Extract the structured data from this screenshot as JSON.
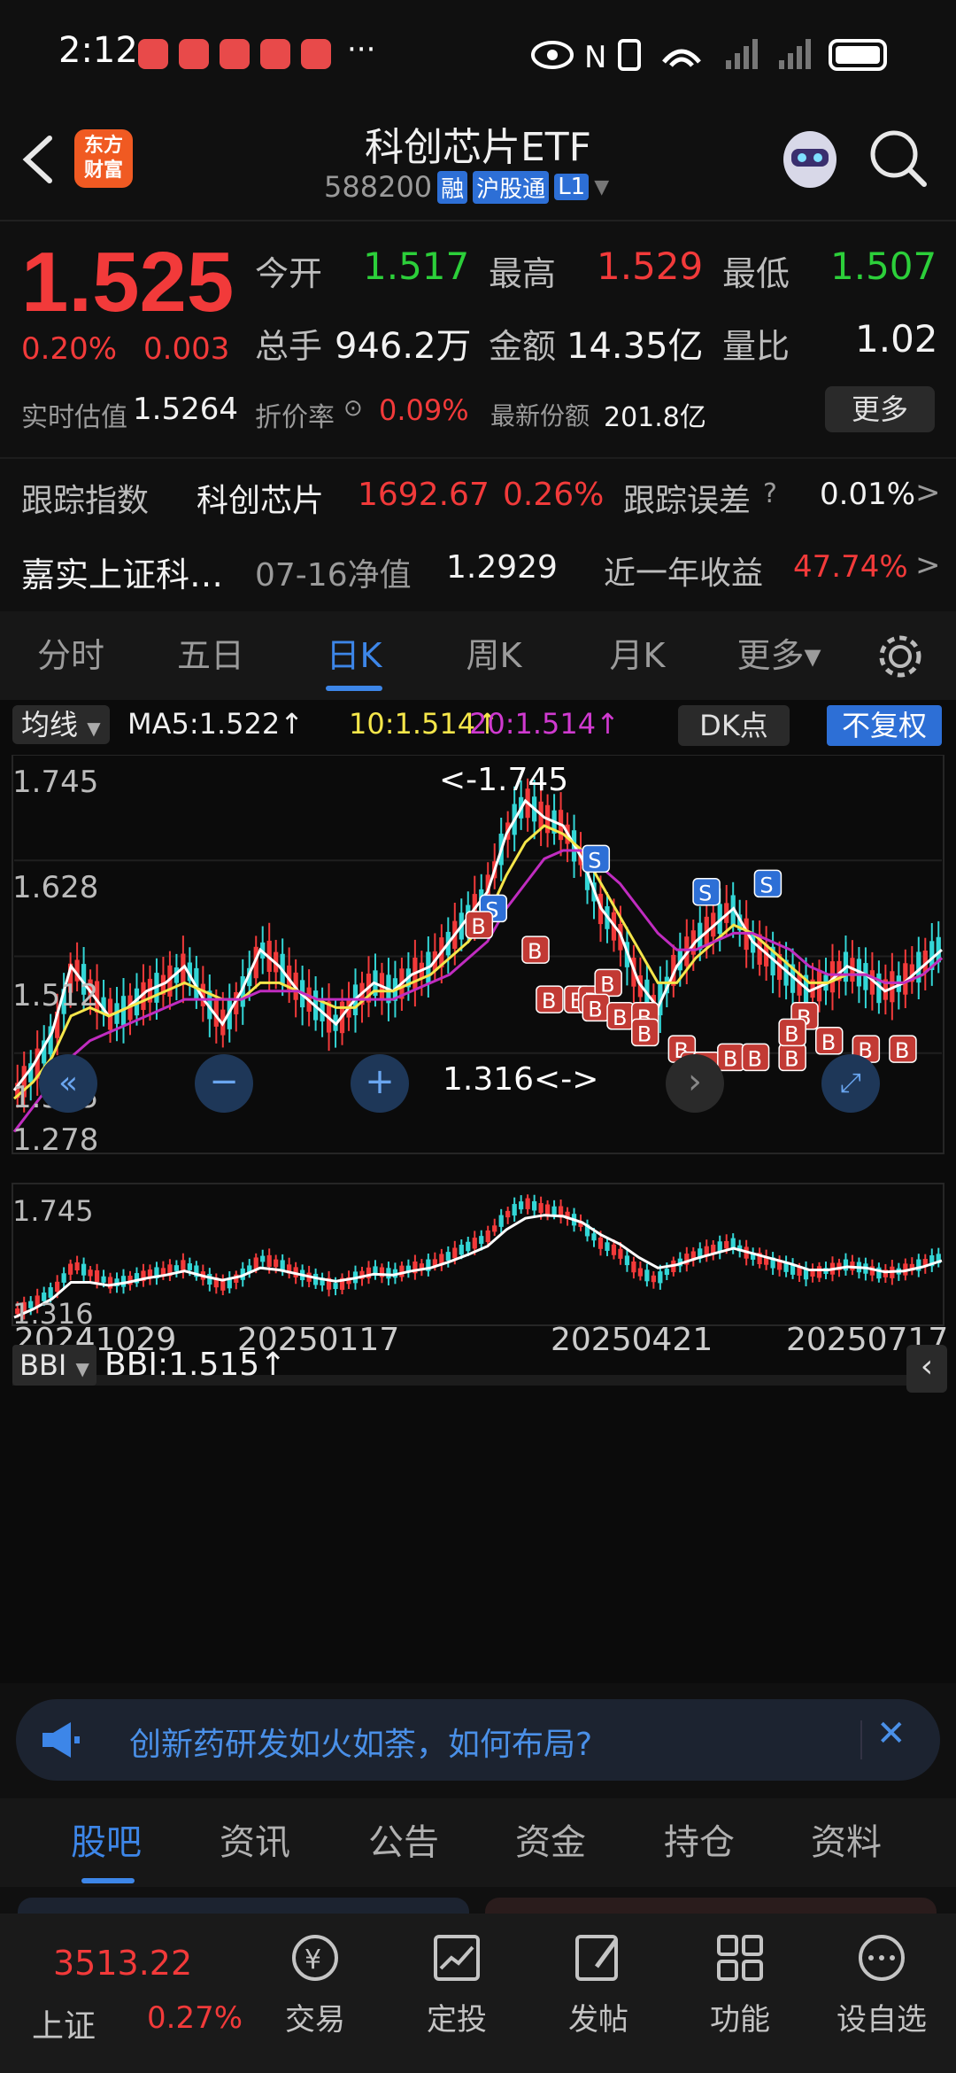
{
  "status_bar": {
    "time": "2:12",
    "more": "···"
  },
  "header": {
    "logo_text": "东方\n财富",
    "title": "科创芯片ETF",
    "code": "588200",
    "badges": [
      "融",
      "沪股通",
      "L1"
    ]
  },
  "quote": {
    "price": "1.525",
    "change_pct": "0.20%",
    "change_abs": "0.003",
    "open_label": "今开",
    "open": "1.517",
    "high_label": "最高",
    "high": "1.529",
    "low_label": "最低",
    "low": "1.507",
    "volume_label": "总手",
    "volume": "946.2万",
    "amount_label": "金额",
    "amount": "14.35亿",
    "ratio_label": "量比",
    "ratio": "1.02",
    "iopv_label": "实时估值",
    "iopv": "1.5264",
    "premium_label": "折价率",
    "premium": "0.09%",
    "shares_label": "最新份额",
    "shares": "201.8亿",
    "more_btn": "更多",
    "track_label": "跟踪指数",
    "track_name": "科创芯片",
    "track_value": "1692.67",
    "track_pct": "0.26%",
    "error_label": "跟踪误差",
    "error_value": "0.01%",
    "fund_name": "嘉实上证科…",
    "nav_label": "07-16净值",
    "nav_value": "1.2929",
    "yield_label": "近一年收益",
    "yield_value": "47.74%",
    "chevron": ">"
  },
  "tabs": [
    {
      "label": "分时"
    },
    {
      "label": "五日"
    },
    {
      "label": "日K"
    },
    {
      "label": "周K"
    },
    {
      "label": "月K"
    },
    {
      "label": "更多▾"
    }
  ],
  "chart_toolbar": {
    "ma_select": "均线",
    "ma5": "MA5:1.522↑",
    "ma10": "10:1.514↑",
    "ma20": "20:1.514↑",
    "dk_btn": "DK点",
    "fq_btn": "不复权"
  },
  "chart_controls": {
    "range_text": "1.316<->"
  },
  "sub_toolbar": {
    "indicator": "BBI",
    "bbi_value": "BBI:1.515↑"
  },
  "colors": {
    "up": "#f23a3a",
    "down": "#33d6d6",
    "ma5": "#ffffff",
    "ma10": "#f5e64a",
    "ma20": "#c02cc0",
    "accent": "#3d86e8"
  },
  "chart_data": {
    "type": "line",
    "title": "",
    "y_ticks": [
      "1.745",
      "1.628",
      "1.512",
      "1.395",
      "1.278"
    ],
    "high_marker": "<-1.745",
    "ylim": [
      1.278,
      1.745
    ],
    "x_ticks": [
      "20241029",
      "20250117",
      "20250421",
      "20250717"
    ],
    "series": [
      {
        "name": "MA5",
        "values": [
          1.35,
          1.38,
          1.42,
          1.5,
          1.47,
          1.44,
          1.45,
          1.47,
          1.48,
          1.5,
          1.46,
          1.43,
          1.47,
          1.52,
          1.5,
          1.47,
          1.45,
          1.43,
          1.46,
          1.48,
          1.47,
          1.49,
          1.5,
          1.53,
          1.56,
          1.59,
          1.66,
          1.7,
          1.68,
          1.67,
          1.63,
          1.57,
          1.54,
          1.48,
          1.45,
          1.5,
          1.53,
          1.55,
          1.57,
          1.53,
          1.51,
          1.49,
          1.47,
          1.48,
          1.5,
          1.49,
          1.47,
          1.48,
          1.5,
          1.52
        ]
      },
      {
        "name": "10",
        "values": [
          1.34,
          1.36,
          1.39,
          1.44,
          1.45,
          1.44,
          1.45,
          1.46,
          1.47,
          1.48,
          1.47,
          1.46,
          1.46,
          1.48,
          1.48,
          1.47,
          1.46,
          1.45,
          1.45,
          1.47,
          1.47,
          1.48,
          1.49,
          1.51,
          1.53,
          1.56,
          1.61,
          1.65,
          1.67,
          1.66,
          1.64,
          1.6,
          1.56,
          1.52,
          1.48,
          1.48,
          1.51,
          1.53,
          1.55,
          1.54,
          1.52,
          1.5,
          1.48,
          1.48,
          1.49,
          1.49,
          1.48,
          1.48,
          1.49,
          1.51
        ]
      },
      {
        "name": "20",
        "values": [
          1.3,
          1.33,
          1.36,
          1.39,
          1.41,
          1.42,
          1.43,
          1.44,
          1.45,
          1.46,
          1.46,
          1.46,
          1.46,
          1.47,
          1.47,
          1.47,
          1.46,
          1.46,
          1.46,
          1.46,
          1.46,
          1.47,
          1.48,
          1.49,
          1.51,
          1.53,
          1.57,
          1.6,
          1.63,
          1.64,
          1.64,
          1.62,
          1.6,
          1.57,
          1.54,
          1.52,
          1.52,
          1.53,
          1.54,
          1.54,
          1.53,
          1.52,
          1.5,
          1.49,
          1.49,
          1.49,
          1.48,
          1.48,
          1.49,
          1.51
        ]
      }
    ]
  },
  "sub_chart": {
    "y_top": "1.745",
    "y_bottom": "1.316"
  },
  "banner": {
    "text": "创新药研发如火如荼，如何布局?",
    "close": "✕"
  },
  "bottom_tabs": [
    {
      "label": "股吧"
    },
    {
      "label": "资讯"
    },
    {
      "label": "公告"
    },
    {
      "label": "资金"
    },
    {
      "label": "持仓"
    },
    {
      "label": "资料"
    }
  ],
  "index": {
    "value": "3513.22",
    "name": "上证",
    "pct": "0.27%"
  },
  "nav": [
    {
      "label": "交易"
    },
    {
      "label": "定投"
    },
    {
      "label": "发帖"
    },
    {
      "label": "功能"
    },
    {
      "label": "设自选"
    }
  ]
}
